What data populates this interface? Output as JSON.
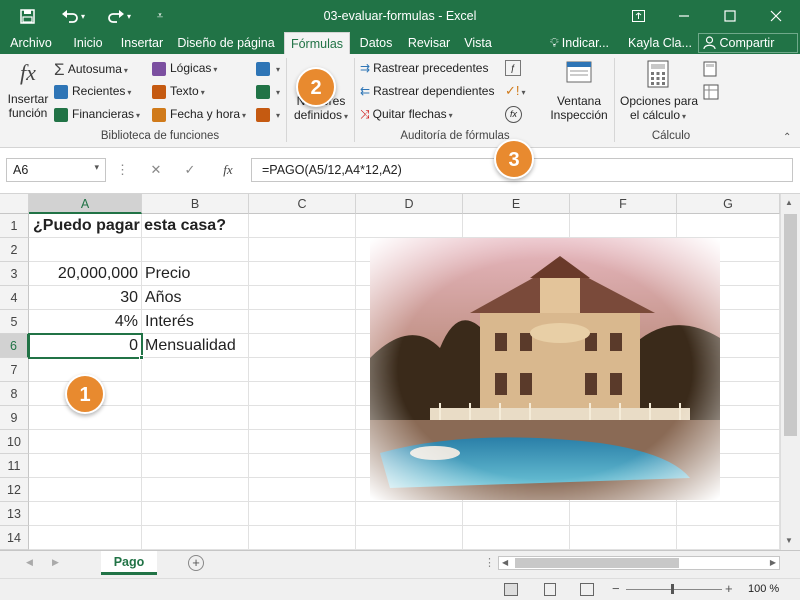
{
  "window": {
    "title": "03-evaluar-formulas  -  Excel",
    "min_icon": "minimize-icon",
    "restore_icon": "restore-icon",
    "close_icon": "close-icon"
  },
  "tabs": [
    {
      "label": "Archivo"
    },
    {
      "label": "Inicio"
    },
    {
      "label": "Insertar"
    },
    {
      "label": "Diseño de página"
    },
    {
      "label": "Fórmulas"
    },
    {
      "label": "Datos"
    },
    {
      "label": "Revisar"
    },
    {
      "label": "Vista"
    }
  ],
  "tell_me": "Indicar...",
  "user": "Kayla Cla...",
  "share": "Compartir",
  "ribbon": {
    "insert_function": [
      "Insertar",
      "función"
    ],
    "autosum": "Autosuma",
    "recent": "Recientes",
    "financial": "Financieras",
    "logical": "Lógicas",
    "text": "Texto",
    "datetime": "Fecha y hora",
    "defined_names": [
      "Nombres",
      "definidos"
    ],
    "trace_precedents": "Rastrear precedentes",
    "trace_dependents": "Rastrear dependientes",
    "remove_arrows": "Quitar flechas",
    "watch_window": [
      "Ventana",
      "Inspección"
    ],
    "calc_options": [
      "Opciones para",
      "el cálculo"
    ],
    "group_library": "Biblioteca de funciones",
    "group_audit": "Auditoría de fórmulas",
    "group_calc": "Cálculo"
  },
  "formula_bar": {
    "name_box": "A6",
    "fx": "fx",
    "formula": "=PAGO(A5/12,A4*12,A2)"
  },
  "columns": [
    "A",
    "B",
    "C",
    "D",
    "E",
    "F",
    "G"
  ],
  "rows": [
    "1",
    "2",
    "3",
    "4",
    "5",
    "6",
    "7",
    "8",
    "9",
    "10",
    "11",
    "12",
    "13",
    "14"
  ],
  "cells": {
    "A1": "¿Puedo pagar esta casa?",
    "A3": "20,000,000",
    "B3": "Precio",
    "A4": "30",
    "B4": "Años",
    "A5": "4%",
    "B5": "Interés",
    "A6": "0",
    "B6": "Mensualidad"
  },
  "sheet_tab": "Pago",
  "status": {
    "zoom": "100 %"
  },
  "callouts": [
    "1",
    "2",
    "3"
  ],
  "colors": {
    "accent": "#217346",
    "callout": "#e88a2f"
  }
}
